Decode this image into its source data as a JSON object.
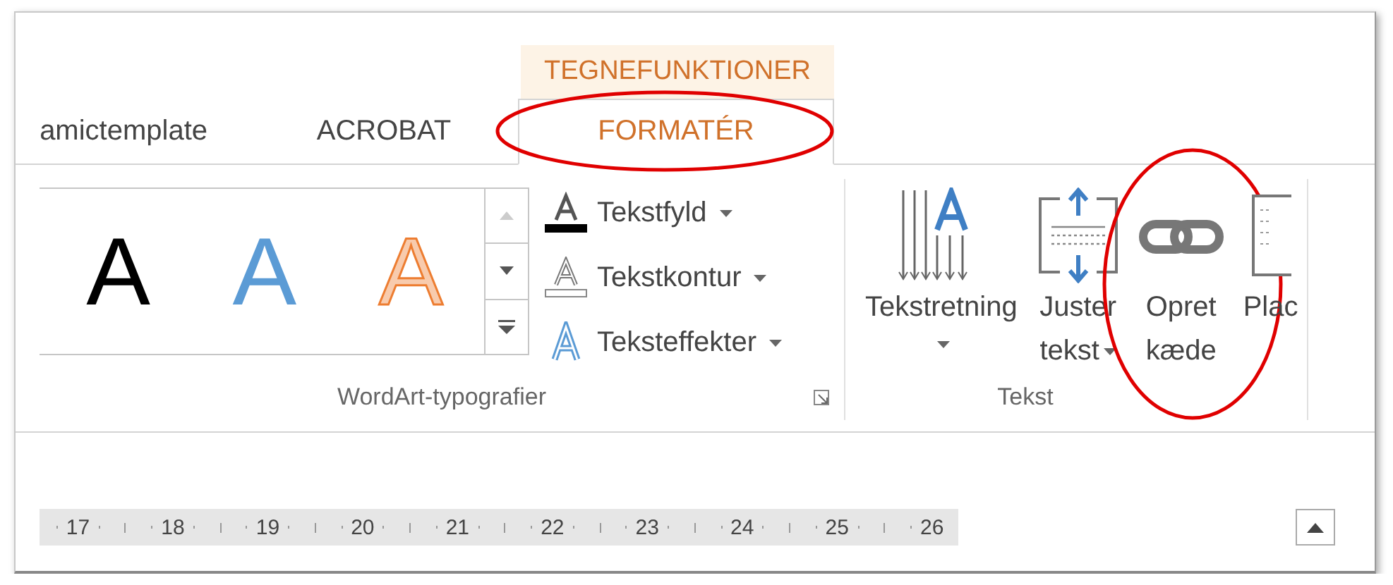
{
  "contextual_tab_group": {
    "label": "TEGNEFUNKTIONER"
  },
  "tabs": [
    {
      "label": "amictemplate",
      "selected": false,
      "circled": false
    },
    {
      "label": "ACROBAT",
      "selected": false,
      "circled": false
    },
    {
      "label": "FORMATÉR",
      "selected": true,
      "circled": true
    }
  ],
  "wordart_group": {
    "label": "WordArt-typografier",
    "gallery": [
      {
        "glyph": "A",
        "kind": "solid"
      },
      {
        "glyph": "A",
        "kind": "blue"
      },
      {
        "glyph": "A",
        "kind": "outline"
      }
    ],
    "scroll_up": {
      "disabled": true
    },
    "commands": [
      {
        "label": "Tekstfyld",
        "kind": "fill",
        "dropdown": true
      },
      {
        "label": "Tekstkontur",
        "kind": "outline",
        "dropdown": true
      },
      {
        "label": "Teksteffekter",
        "kind": "effects",
        "dropdown": true
      }
    ]
  },
  "text_group": {
    "label": "Tekst",
    "buttons": [
      {
        "lines": [
          "Tekstretning"
        ],
        "kind": "direction",
        "dropdown": true,
        "circled": false
      },
      {
        "lines": [
          "Juster",
          "tekst"
        ],
        "kind": "align",
        "dropdown": true,
        "circled": false
      },
      {
        "lines": [
          "Opret",
          "kæde"
        ],
        "kind": "link",
        "dropdown": false,
        "circled": true
      },
      {
        "lines": [
          "Plac"
        ],
        "kind": "document",
        "dropdown": false,
        "circled": false
      }
    ]
  },
  "ruler": {
    "numbers": [
      "17",
      "18",
      "19",
      "20",
      "21",
      "22",
      "23",
      "24",
      "25",
      "26"
    ]
  }
}
